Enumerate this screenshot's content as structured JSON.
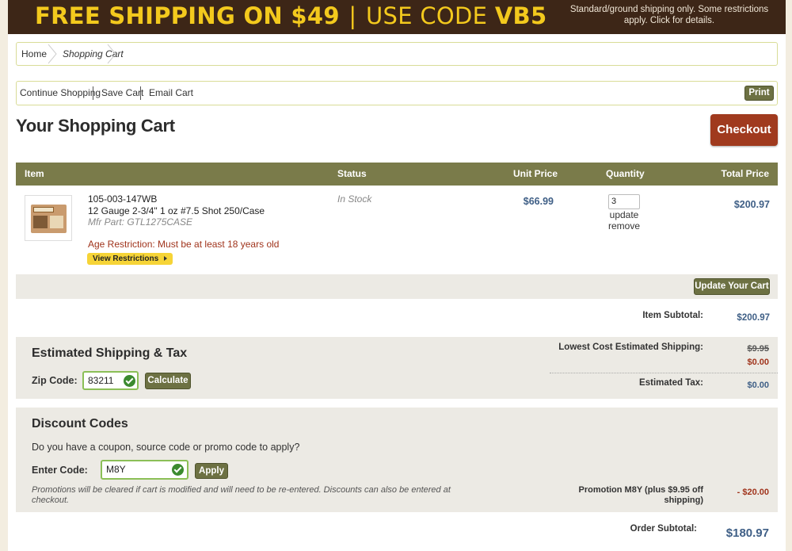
{
  "banner": {
    "part1": "FREE SHIPPING ON $49",
    "separator": "|",
    "part2": "USE CODE",
    "code": "VB5",
    "note": "Standard/ground shipping only. Some restrictions apply. Click for details."
  },
  "breadcrumb": {
    "home": "Home",
    "current": "Shopping Cart"
  },
  "actions": {
    "continue": "Continue Shopping",
    "save": "Save Cart",
    "email": "Email Cart",
    "print": "Print"
  },
  "page_title": "Your Shopping Cart",
  "checkout_label": "Checkout",
  "table": {
    "headers": {
      "item": "Item",
      "status": "Status",
      "unit_price": "Unit Price",
      "quantity": "Quantity",
      "total_price": "Total Price"
    },
    "items": [
      {
        "sku": "105-003-147WB",
        "name": "12 Gauge 2-3/4\" 1 oz #7.5 Shot 250/Case",
        "mfr_part": "Mfr Part: GTL1275CASE",
        "age_restriction": "Age Restriction: Must be at least 18 years old",
        "view_restrictions": "View Restrictions",
        "status": "In Stock",
        "unit_price": "$66.99",
        "quantity": "3",
        "update_label": "update",
        "remove_label": "remove",
        "total_price": "$200.97",
        "thumb_icon": "ammo-box-image"
      }
    ]
  },
  "update_cart_label": "Update Your Cart",
  "item_subtotal": {
    "label": "Item Subtotal:",
    "value": "$200.97"
  },
  "shipping": {
    "title": "Estimated Shipping & Tax",
    "zip_label": "Zip Code:",
    "zip_value": "83211",
    "calculate_label": "Calculate",
    "lowest_label": "Lowest Cost Estimated Shipping:",
    "lowest_original": "$9.95",
    "lowest_value": "$0.00",
    "tax_label": "Estimated Tax:",
    "tax_value": "$0.00"
  },
  "discount": {
    "title": "Discount Codes",
    "question": "Do you have a coupon, source code or promo code to apply?",
    "code_label": "Enter Code:",
    "code_value": "M8Y",
    "apply_label": "Apply",
    "note": "Promotions will be cleared if cart is modified and will need to be re-entered. Discounts can also be entered at checkout.",
    "promo_label": "Promotion M8Y (plus $9.95 off shipping)",
    "promo_value": "- $20.00"
  },
  "order_subtotal": {
    "label": "Order Subtotal:",
    "value": "$180.97"
  },
  "colors": {
    "banner_bg": "#3d2617",
    "banner_text": "#f3c91d",
    "olive": "#7a7b4a",
    "checkout": "#a03a1e",
    "price_blue": "#3f5f86",
    "alert_red": "#a0341c",
    "panel_bg": "#eceae4"
  }
}
